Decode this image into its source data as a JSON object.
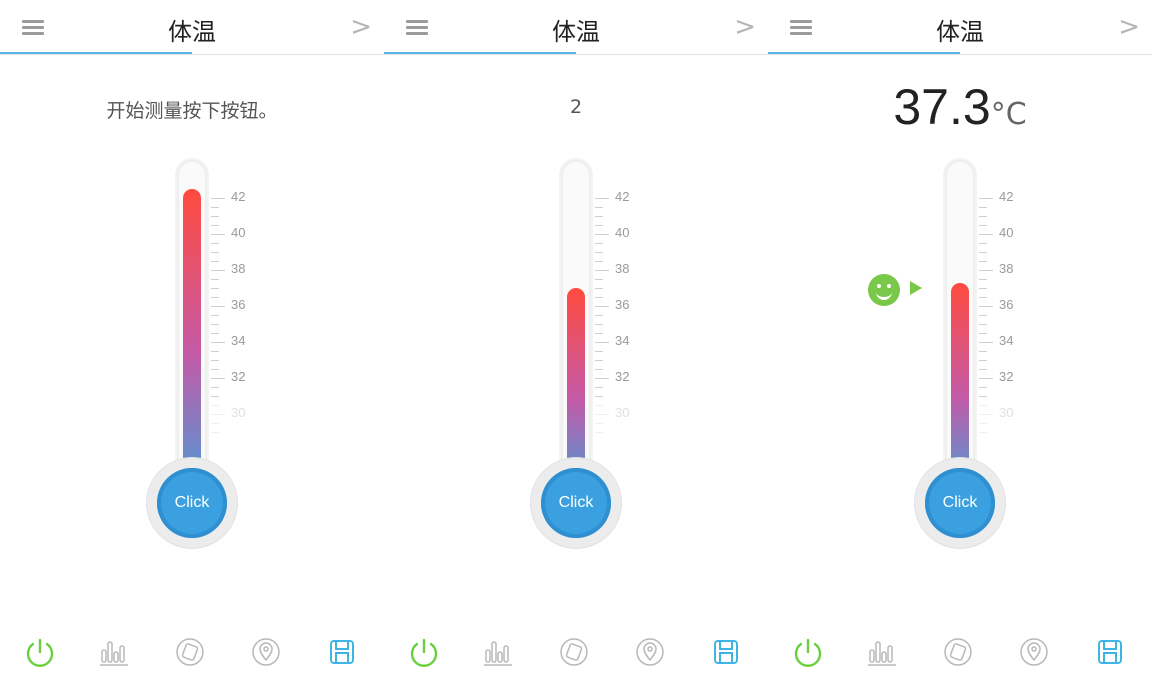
{
  "screens": [
    {
      "title": "体温",
      "status_text": "开始测量按下按钮。",
      "bulb_label": "Click",
      "fill_level_celsius": 42.5
    },
    {
      "title": "体温",
      "countdown": "2",
      "bulb_label": "Click",
      "fill_level_celsius": 37.0
    },
    {
      "title": "体温",
      "temperature": "37.3",
      "unit": "°C",
      "bulb_label": "Click",
      "fill_level_celsius": 37.3
    }
  ],
  "scale_labels": [
    "42",
    "40",
    "38",
    "36",
    "34",
    "32",
    "30"
  ],
  "icons": {
    "menu": "menu-icon",
    "next": "chevron-right-icon",
    "power": "power-icon",
    "history": "bar-chart-icon",
    "device": "device-icon",
    "location": "location-icon",
    "save": "save-icon"
  },
  "colors": {
    "accent": "#58b6ea",
    "bulb": "#3aa0df",
    "green": "#79c84a",
    "hot": "#ff4b3e"
  }
}
